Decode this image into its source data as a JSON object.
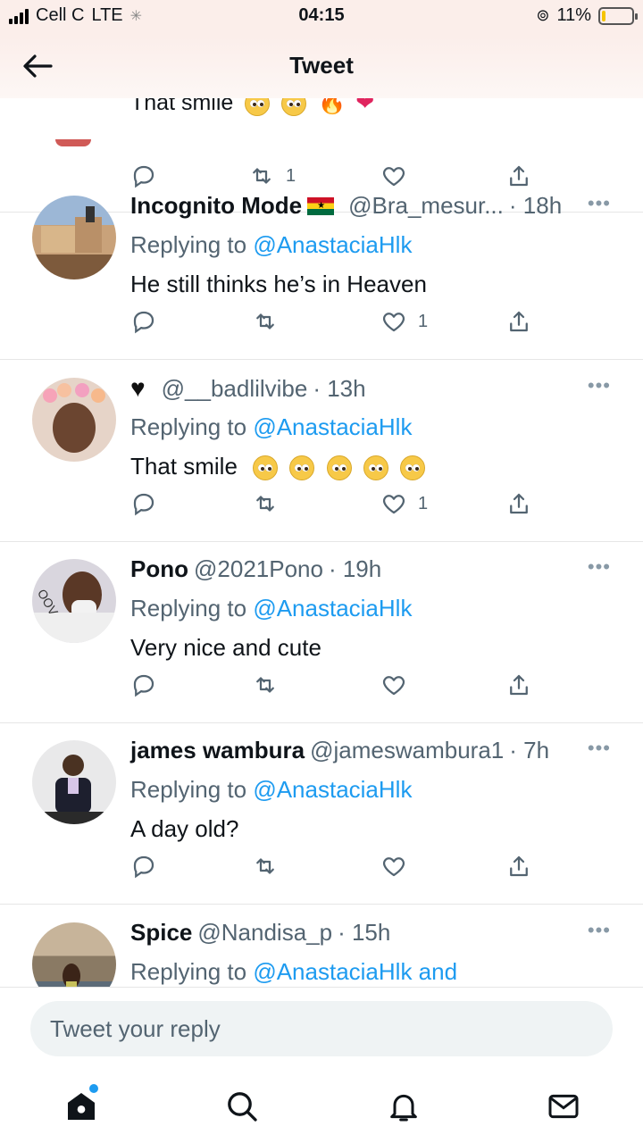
{
  "status_bar": {
    "carrier": "Cell C",
    "network": "LTE",
    "time": "04:15",
    "battery_pct": "11%",
    "battery_level": 0.11
  },
  "header": {
    "title": "Tweet"
  },
  "partial_tweet": {
    "text": "That smile",
    "retweets": "1"
  },
  "tweets": [
    {
      "name": "Incognito Mode",
      "handle": "@Bra_mesur...",
      "time": "· 18h",
      "replying_label": "Replying to",
      "replying_to": "@AnastaciaHlk",
      "text": "He still thinks he’s in Heaven",
      "replies": "",
      "retweets": "",
      "likes": "1"
    },
    {
      "name": "",
      "handle": "@__badlilvibe",
      "time": "· 13h",
      "replying_label": "Replying to",
      "replying_to": "@AnastaciaHlk",
      "text": "That smile",
      "replies": "",
      "retweets": "",
      "likes": "1"
    },
    {
      "name": "Pono",
      "handle": "@2021Pono",
      "time": "· 19h",
      "replying_label": "Replying to",
      "replying_to": "@AnastaciaHlk",
      "text": "Very nice and cute",
      "replies": "",
      "retweets": "",
      "likes": ""
    },
    {
      "name": "james wambura",
      "handle": "@jameswambura1",
      "time": "· 7h",
      "replying_label": "Replying to",
      "replying_to": "@AnastaciaHlk",
      "text": "A day old?",
      "replies": "",
      "retweets": "",
      "likes": ""
    },
    {
      "name": "Spice",
      "handle": "@Nandisa_p",
      "time": "· 15h",
      "replying_label": "Replying to",
      "replying_to": "@AnastaciaHlk and",
      "text": "",
      "replies": "",
      "retweets": "",
      "likes": ""
    }
  ],
  "composer": {
    "placeholder": "Tweet your reply"
  },
  "colors": {
    "accent": "#1d9bf0",
    "muted": "#536471"
  },
  "tabs": [
    "home-icon",
    "search-icon",
    "notifications-icon",
    "messages-icon"
  ]
}
